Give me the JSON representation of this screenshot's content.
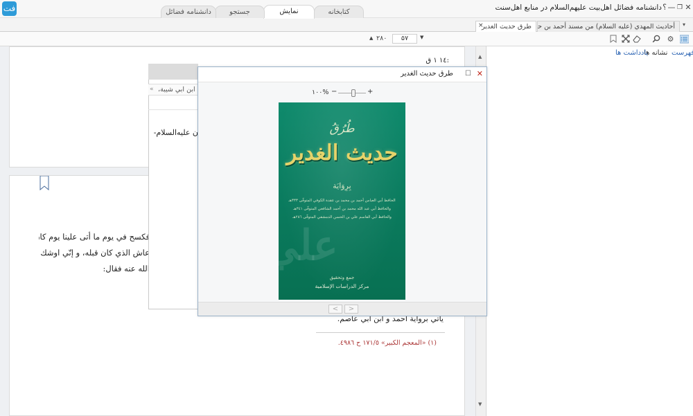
{
  "window": {
    "title": "دانشنامه فضائل اهل‌بیت علیهم‌السلام در منابع اهل‌سنت",
    "logo_text": "فت",
    "controls": {
      "help": "؟",
      "minimize": "—",
      "restore": "❐",
      "close": "✕"
    }
  },
  "main_tabs": [
    {
      "label": "کتابخانه"
    },
    {
      "label": "نمایش"
    },
    {
      "label": "جستجو"
    },
    {
      "label": "دانشنامه فضائل"
    }
  ],
  "doc_tabs": [
    {
      "label": "أحاديث المهدي (عليه السلام) من مسند أحمد بن حنبل"
    },
    {
      "label": "طرق حديث الغدير",
      "close": "×"
    }
  ],
  "doc_tabs_menu": "▾",
  "toolbar": {
    "page_current": "۵۷",
    "page_total": "۲۸۰",
    "up_arrow": "▲",
    "down_arrow": "▼"
  },
  "sidebar": {
    "tabs": [
      "فهرست",
      "نشانه ها",
      "یادداشت ها"
    ]
  },
  "document": {
    "top_fragment": ":١٤ ١ ق",
    "dialog1_row_text": "ابن ابي شيبة،",
    "dialog1_nav": "«",
    "dialog1_frag": "ن  عليه‌السلام-",
    "page2_lines": [
      "فكسح في يوم ما أتى علينا يوم كان",
      "عاش الذي كان قبله، و إنّي اوشك أن",
      "الله عنه فقال:"
    ],
    "page2_end_line": "يأتي برواية أحمد و ابن أبي عاصم.",
    "footnote": "(١) «المعجم الكبير» ١٧١/٥ ح ٤٩٨٦."
  },
  "image_dialog": {
    "title": "طرق حديث الغدير",
    "zoom": "١٠٠%",
    "zoom_minus": "−",
    "zoom_plus": "+",
    "zoom_level_fraction": 0.55,
    "nav_prev": "<",
    "nav_next": ">",
    "close": "✕",
    "maximize": "☐",
    "cover": {
      "title_top": "طُرُقُ",
      "title_main": "حديث الغدير",
      "subtitle": "بِرِوَايَة",
      "authors": [
        "الحافظ أبي العباس أحمد بن محمد بن عقدة الكوفي المتوفّى ٣٣٣هـ",
        "والحافظ أبي عبد الله محمد بن أحمد الشافعي المتوفّى ٣٤١هـ",
        "والحافظ أبي القاسم علي بن الحسن الدمشقي المتوفّى ٢٨٦هـ"
      ],
      "watermark": "علي",
      "publisher_top": "جمع وتحقيق",
      "publisher_bottom": "مركز الدراسات الإسلامية"
    }
  },
  "colors": {
    "accent": "#2e9bd8",
    "cover_green": "#0a7a5d",
    "cover_gold": "#e6d36a",
    "close_red": "#c0271a",
    "footnote_red": "#a33"
  }
}
